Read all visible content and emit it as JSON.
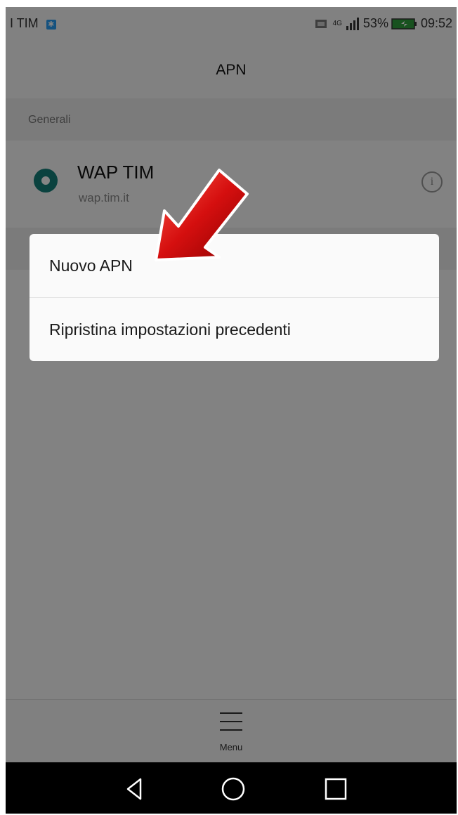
{
  "status_bar": {
    "carrier": "I TIM",
    "bt_badge": "✱",
    "network": "4G",
    "battery_percent": "53%",
    "time": "09:52"
  },
  "app_bar": {
    "title": "APN"
  },
  "sections": {
    "general_label": "Generali"
  },
  "apn_list": [
    {
      "name": "WAP TIM",
      "apn": "wap.tim.it",
      "selected": true,
      "info_label": "i"
    }
  ],
  "dialog": {
    "options": [
      {
        "label": "Nuovo APN"
      },
      {
        "label": "Ripristina impostazioni precedenti"
      }
    ]
  },
  "bottom_bar": {
    "menu_label": "Menu"
  },
  "colors": {
    "accent": "#147f7a",
    "arrow": "#d01010",
    "overlay": "rgba(0,0,0,0.48)"
  },
  "icons": {
    "radio": "radio-selected-icon",
    "info": "info-icon",
    "menu": "menu-icon",
    "back": "back-triangle-icon",
    "home": "home-circle-icon",
    "recents": "recents-square-icon",
    "annotation": "red-arrow-icon"
  }
}
